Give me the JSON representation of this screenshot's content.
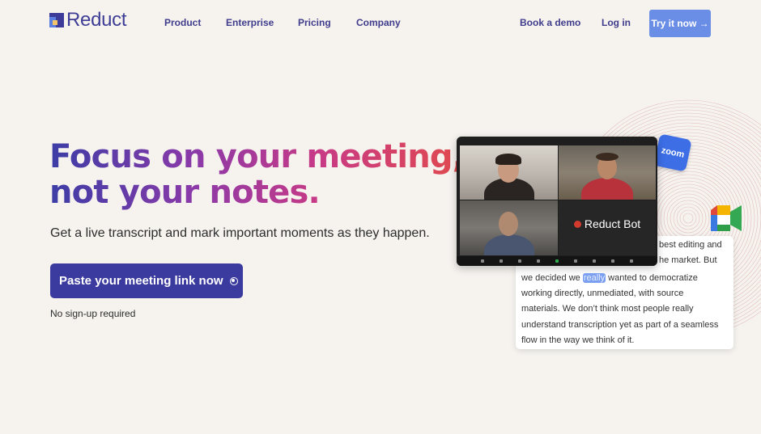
{
  "header": {
    "logo_text": "Reduct",
    "nav": [
      "Product",
      "Enterprise",
      "Pricing",
      "Company"
    ],
    "book_demo": "Book a demo",
    "login": "Log in",
    "try_now": "Try it now →"
  },
  "hero": {
    "title_line1": "Focus on your meeting,",
    "title_line2": "not your notes.",
    "subtitle": "Get a live transcript and mark important moments as they happen.",
    "cta_label": "Paste your meeting link now",
    "note": "No sign-up required"
  },
  "illustration": {
    "bot_name": "Reduct Bot",
    "zoom_badge": "zoom",
    "transcript": {
      "line1_partial": "best editing and",
      "line2_partial": "he market. But",
      "line3_before": "we decided we ",
      "line3_highlight": "really",
      "line3_after": " wanted to democratize",
      "line4": "working directly, unmediated, with source",
      "line5": "materials. We don’t think most people really",
      "line6": "understand transcription yet as part of a seamless",
      "line7": "flow in the way we think of it."
    }
  },
  "colors": {
    "background": "#f6f3ef",
    "brand": "#3b3a9e",
    "accent_button": "#6a8ee6",
    "gradient_start": "#3c3da6",
    "gradient_end": "#e04a4d"
  }
}
